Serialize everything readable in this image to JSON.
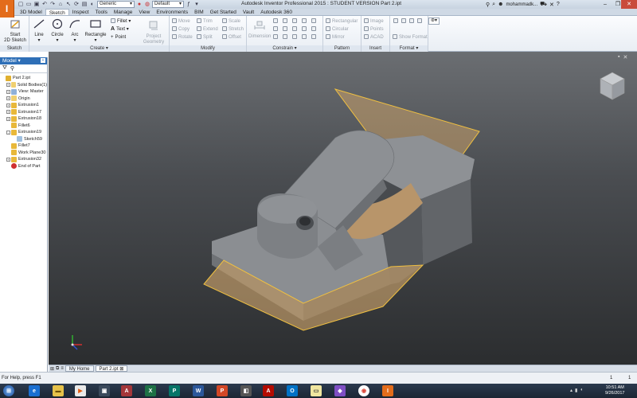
{
  "app": {
    "logo_letter": "I",
    "title": "Autodesk Inventor Professional 2015 : STUDENT VERSION    Part 2.ipt"
  },
  "quick_access": {
    "material": "Generic",
    "appearance": "Default"
  },
  "title_right": {
    "user": "mohammadk..."
  },
  "tabs": [
    "3D Model",
    "Sketch",
    "Inspect",
    "Tools",
    "Manage",
    "View",
    "Environments",
    "BIM",
    "Get Started",
    "Vault",
    "Autodesk 360"
  ],
  "active_tab": "Sketch",
  "ribbon": {
    "sketch_panel": {
      "start_line1": "Start",
      "start_line2": "2D Sketch",
      "label": "Sketch"
    },
    "create_panel": {
      "line": "Line",
      "circle": "Circle",
      "arc": "Arc",
      "rectangle": "Rectangle",
      "fillet": "Fillet",
      "text": "Text",
      "point": "Point",
      "project_line1": "Project",
      "project_line2": "Geometry",
      "label": "Create"
    },
    "modify_panel": {
      "move": "Move",
      "trim": "Trim",
      "scale": "Scale",
      "copy": "Copy",
      "extend": "Extend",
      "stretch": "Stretch",
      "rotate": "Rotate",
      "split": "Split",
      "offset": "Offset",
      "label": "Modify"
    },
    "constrain_panel": {
      "dimension": "Dimension",
      "label": "Constrain"
    },
    "pattern_panel": {
      "rectangular": "Rectangular",
      "circular": "Circular",
      "mirror": "Mirror",
      "label": "Pattern"
    },
    "insert_panel": {
      "image": "Image",
      "points": "Points",
      "acad": "ACAD",
      "label": "Insert"
    },
    "format_panel": {
      "show_format": "Show Format",
      "label": "Format"
    }
  },
  "browser": {
    "title": "Model",
    "items": [
      {
        "label": "Part 2.ipt",
        "level": 0,
        "exp": "",
        "icon": "part"
      },
      {
        "label": "Solid Bodies(1)",
        "level": 1,
        "exp": "+",
        "icon": "folder"
      },
      {
        "label": "View: Master",
        "level": 1,
        "exp": "+",
        "icon": "view"
      },
      {
        "label": "Origin",
        "level": 1,
        "exp": "+",
        "icon": "folder"
      },
      {
        "label": "Extrusion1",
        "level": 1,
        "exp": "+",
        "icon": "feature"
      },
      {
        "label": "Extrusion17",
        "level": 1,
        "exp": "+",
        "icon": "feature"
      },
      {
        "label": "Extrusion18",
        "level": 1,
        "exp": "+",
        "icon": "feature"
      },
      {
        "label": "Fillet6",
        "level": 1,
        "exp": "",
        "icon": "fillet"
      },
      {
        "label": "Extrusion19",
        "level": 1,
        "exp": "-",
        "icon": "feature"
      },
      {
        "label": "Sketch59",
        "level": 2,
        "exp": "",
        "icon": "sketch"
      },
      {
        "label": "Fillet7",
        "level": 1,
        "exp": "",
        "icon": "fillet"
      },
      {
        "label": "Work Plane30",
        "level": 1,
        "exp": "",
        "icon": "plane"
      },
      {
        "label": "Extrusion32",
        "level": 1,
        "exp": "+",
        "icon": "feature"
      },
      {
        "label": "End of Part",
        "level": 1,
        "exp": "",
        "icon": "end"
      }
    ]
  },
  "doc_tabs": [
    "My Home",
    "Part 2.ipt"
  ],
  "status": {
    "help_text": "For Help, press F1",
    "count1": "1",
    "count2": "1"
  },
  "taskbar": {
    "time": "10:51 AM",
    "date": "9/26/2017"
  },
  "colors": {
    "accent": "#2e6fb7",
    "plane_fill": "#c8a06a",
    "plane_edge": "#f0c040",
    "model_face": "#8c8f93"
  }
}
